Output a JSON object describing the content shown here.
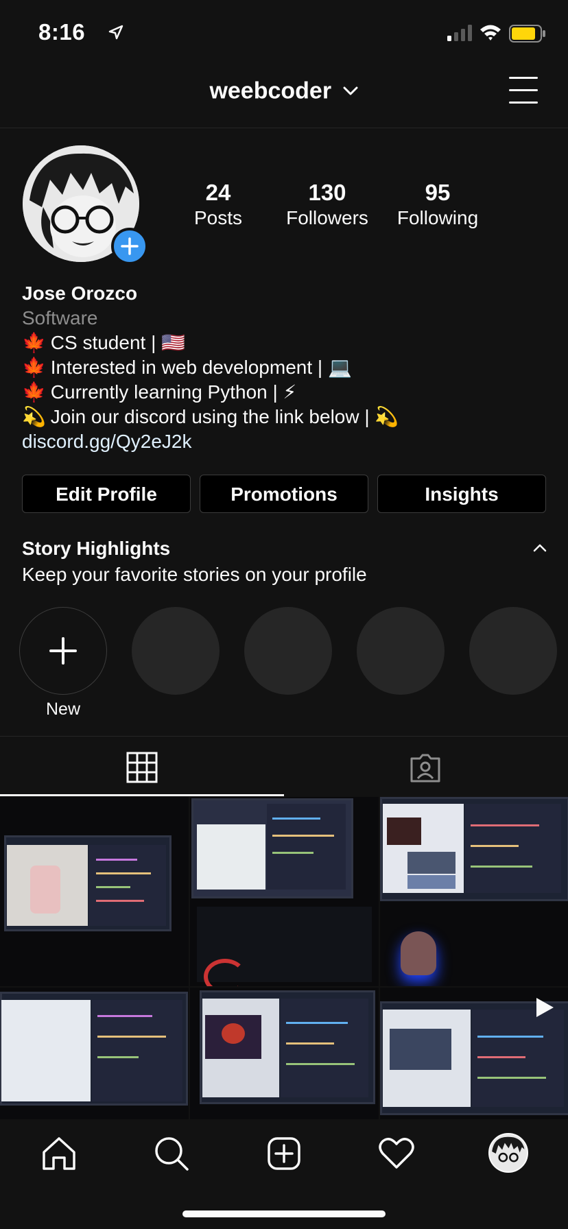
{
  "status_bar": {
    "time": "8:16"
  },
  "header": {
    "username": "weebcoder"
  },
  "profile": {
    "stats": [
      {
        "value": "24",
        "label": "Posts"
      },
      {
        "value": "130",
        "label": "Followers"
      },
      {
        "value": "95",
        "label": "Following"
      }
    ],
    "name": "Jose Orozco",
    "category": "Software",
    "bio_lines": [
      {
        "emoji": "🍁",
        "text": "CS student | 🇺🇸"
      },
      {
        "emoji": "🍁",
        "text": "Interested in web development | 💻"
      },
      {
        "emoji": "🍁",
        "text": "Currently learning Python | ⚡"
      },
      {
        "emoji": "💫",
        "text": "Join our discord using the link below | 💫"
      }
    ],
    "link": "discord.gg/Qy2eJ2k"
  },
  "buttons": {
    "edit_profile": "Edit Profile",
    "promotions": "Promotions",
    "insights": "Insights"
  },
  "highlights": {
    "title": "Story Highlights",
    "subtitle": "Keep your favorite stories on your profile",
    "new_label": "New"
  },
  "colors": {
    "background": "#121212",
    "accent_blue": "#3897f0",
    "battery_yellow": "#ffd60a"
  }
}
